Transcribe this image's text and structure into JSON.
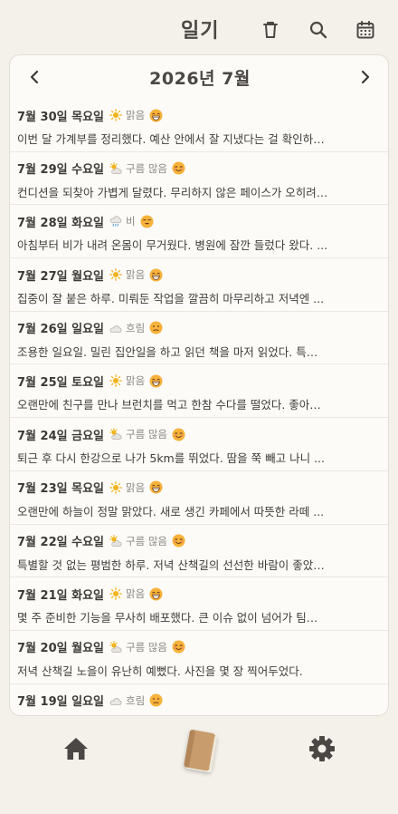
{
  "header": {
    "title": "일기",
    "icons": [
      "trash-icon",
      "search-icon",
      "calendar-icon"
    ]
  },
  "month_nav": {
    "title": "2026년 7월",
    "prev": "‹",
    "next": "›"
  },
  "entries": [
    {
      "date": "7월 30일 목요일",
      "weather": "맑음",
      "weather_icon": "sun-icon",
      "mood_icon": "grin-face-icon",
      "text": "이번 달 가계부를 정리했다. 예산 안에서 잘 지냈다는 걸 확인하…"
    },
    {
      "date": "7월 29일 수요일",
      "weather": "구름 많음",
      "weather_icon": "partly-cloudy-icon",
      "mood_icon": "smile-face-icon",
      "text": "컨디션을 되찾아 가볍게 달렸다. 무리하지 않은 페이스가 오히려…"
    },
    {
      "date": "7월 28일 화요일",
      "weather": "비",
      "weather_icon": "rain-icon",
      "mood_icon": "tired-face-icon",
      "text": "아침부터 비가 내려 온몸이 무거웠다. 병원에 잠깐 들렀다 왔다. ..."
    },
    {
      "date": "7월 27일 월요일",
      "weather": "맑음",
      "weather_icon": "sun-icon",
      "mood_icon": "grin-face-icon",
      "text": "집중이 잘 붙은 하루. 미뤄둔 작업을 깔끔히 마무리하고 저녁엔 ..."
    },
    {
      "date": "7월 26일 일요일",
      "weather": "흐림",
      "weather_icon": "cloud-icon",
      "mood_icon": "neutral-face-icon",
      "text": "조용한 일요일. 밀린 집안일을 하고 읽던 책을 마저 읽었다. 특…"
    },
    {
      "date": "7월 25일 토요일",
      "weather": "맑음",
      "weather_icon": "sun-icon",
      "mood_icon": "grin-face-icon",
      "text": "오랜만에 친구를 만나 브런치를 먹고 한참 수다를 떨었다. 좋아…"
    },
    {
      "date": "7월 24일 금요일",
      "weather": "구름 많음",
      "weather_icon": "partly-cloudy-icon",
      "mood_icon": "smile-face-icon",
      "text": "퇴근 후 다시 한강으로 나가 5km를 뛰었다. 땀을 쭉 빼고 나니 ..."
    },
    {
      "date": "7월 23일 목요일",
      "weather": "맑음",
      "weather_icon": "sun-icon",
      "mood_icon": "grin-face-icon",
      "text": "오랜만에 하늘이 정말 맑았다. 새로 생긴 카페에서 따뜻한 라떼 ..."
    },
    {
      "date": "7월 22일 수요일",
      "weather": "구름 많음",
      "weather_icon": "partly-cloudy-icon",
      "mood_icon": "smile-face-icon",
      "text": "특별할 것 없는 평범한 하루. 저녁 산책길의 선선한 바람이 좋았…"
    },
    {
      "date": "7월 21일 화요일",
      "weather": "맑음",
      "weather_icon": "sun-icon",
      "mood_icon": "grin-face-icon",
      "text": "몇 주 준비한 기능을 무사히 배포했다. 큰 이슈 없이 넘어가 팀…"
    },
    {
      "date": "7월 20일 월요일",
      "weather": "구름 많음",
      "weather_icon": "partly-cloudy-icon",
      "mood_icon": "smile-face-icon",
      "text": "저녁 산책길 노을이 유난히 예뻤다. 사진을 몇 장 찍어두었다."
    },
    {
      "date": "7월 19일 일요일",
      "weather": "흐림",
      "weather_icon": "cloud-icon",
      "mood_icon": "neutral-face-icon",
      "text": ""
    }
  ],
  "bottom_nav": {
    "items": [
      "home-icon",
      "diary-book-icon",
      "settings-gear-icon"
    ]
  },
  "colors": {
    "background": "#f4f1ea",
    "card": "#fcfbf8",
    "icon": "#4a4744",
    "sun": "#f2b41c",
    "face": "#f6b23a",
    "book": "#c89c6c"
  }
}
